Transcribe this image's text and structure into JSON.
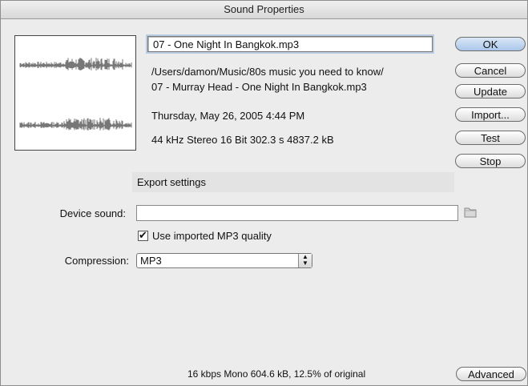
{
  "window": {
    "title": "Sound Properties"
  },
  "sound": {
    "name": "07 - One Night In Bangkok.mp3",
    "path_line1": "/Users/damon/Music/80s music you need to know/",
    "path_line2": "07 - Murray Head - One Night In Bangkok.mp3",
    "date": "Thursday, May 26, 2005  4:44 PM",
    "format": "44 kHz Stereo 16 Bit 302.3 s 4837.2 kB"
  },
  "buttons": {
    "ok": "OK",
    "cancel": "Cancel",
    "update": "Update",
    "import": "Import...",
    "test": "Test",
    "stop": "Stop",
    "advanced": "Advanced"
  },
  "export": {
    "header": "Export settings",
    "device_sound_label": "Device sound:",
    "device_sound_value": "",
    "use_mp3_label": "Use imported MP3 quality",
    "use_mp3_checked": true,
    "compression_label": "Compression:",
    "compression_value": "MP3"
  },
  "footer": {
    "summary": "16 kbps  Mono 604.6 kB, 12.5% of original"
  },
  "icons": {
    "folder": "folder-icon",
    "popup_arrows": "popup-arrows-icon",
    "checkmark": "checkmark-icon"
  }
}
